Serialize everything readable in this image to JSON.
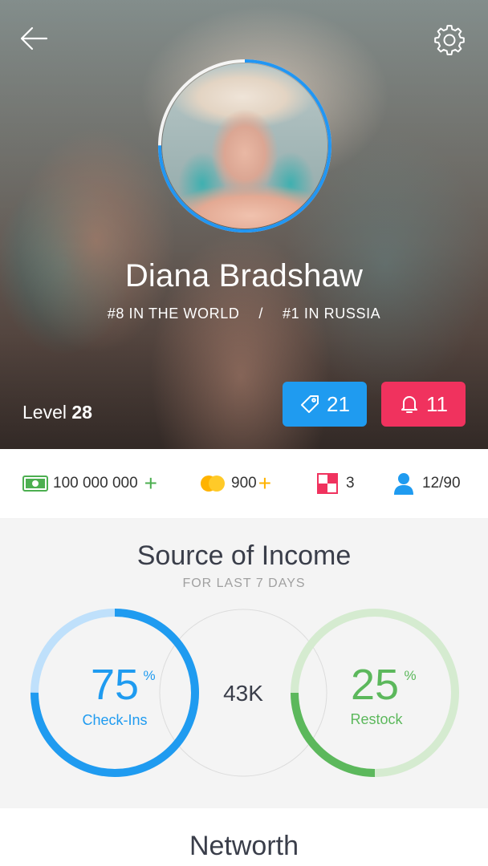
{
  "profile": {
    "name": "Diana Bradshaw",
    "rank_world": "#8 IN THE WORLD",
    "rank_separator": "/",
    "rank_country": "#1 IN RUSSIA",
    "level_label": "Level",
    "level_value": "28",
    "avatar_ring_color": "#2196f3"
  },
  "header": {
    "back_icon": "arrow-left-icon",
    "settings_icon": "gear-icon"
  },
  "badges": {
    "tags": {
      "icon": "tag-icon",
      "count": "21",
      "color": "#1f9bf0"
    },
    "notifications": {
      "icon": "bell-icon",
      "count": "11",
      "color": "#f0325e"
    }
  },
  "stats": {
    "money": {
      "icon": "money-icon",
      "value": "100 000 000",
      "action": "+",
      "color": "#4caf50"
    },
    "coins": {
      "icon": "coins-icon",
      "value": "900",
      "action": "+",
      "color": "#ffb300"
    },
    "blocks": {
      "icon": "blocks-icon",
      "value": "3",
      "color": "#f0325e"
    },
    "users": {
      "icon": "user-icon",
      "value": "12/90",
      "color": "#1f9bf0"
    }
  },
  "income": {
    "title": "Source of Income",
    "subtitle": "FOR LAST 7 DAYS",
    "total": "43K",
    "check_ins": {
      "value": "75",
      "unit": "%",
      "label": "Check-Ins",
      "fraction": 0.75,
      "color": "#1f9bf0",
      "track_color": "#bfe0fb"
    },
    "restock": {
      "value": "25",
      "unit": "%",
      "label": "Restock",
      "fraction": 0.25,
      "color": "#5cb85c",
      "track_color": "#d5ebd0"
    }
  },
  "networth": {
    "title": "Networth"
  }
}
